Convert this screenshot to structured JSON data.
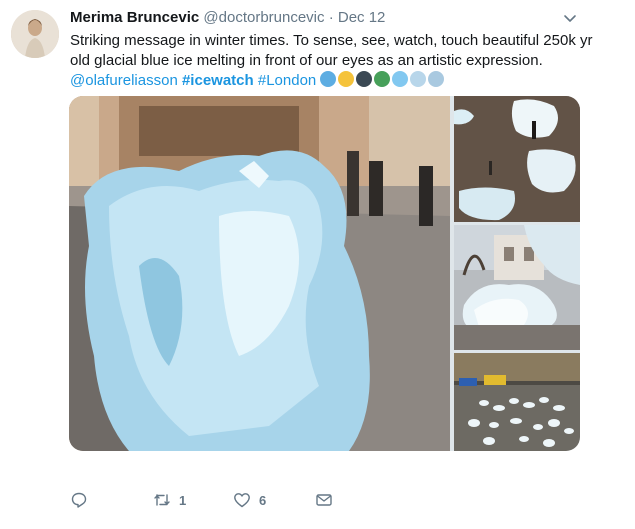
{
  "tweet": {
    "author_name": "Merima Bruncevic",
    "handle": "@doctorbruncevic",
    "separator": "·",
    "date": "Dec 12",
    "text_line1": "Striking message in winter times. To sense, see, watch, touch beautiful 250k yr",
    "text_line2": "old glacial blue ice melting in front of our eyes as an artistic expression.",
    "mention": "@olafureliasson",
    "hashtag1": "#icewatch",
    "hashtag2": "#London",
    "emojis": [
      {
        "name": "blue-heart-emoji",
        "color": "#5dade2"
      },
      {
        "name": "sad-but-relieved-face-emoji",
        "color": "#f5c33b"
      },
      {
        "name": "speaking-head-emoji",
        "color": "#3b4954"
      },
      {
        "name": "globe-emoji",
        "color": "#47a05a"
      },
      {
        "name": "snowflake-emoji",
        "color": "#82c8f0"
      },
      {
        "name": "cloud-with-snow-emoji",
        "color": "#b8d6ea"
      },
      {
        "name": "wind-face-emoji",
        "color": "#a9c9e0"
      }
    ]
  },
  "actions": {
    "reply_count": "",
    "retweet_count": "1",
    "like_count": "6"
  },
  "colors": {
    "link": "#1b95e0",
    "muted": "#657786",
    "text": "#14171a"
  }
}
